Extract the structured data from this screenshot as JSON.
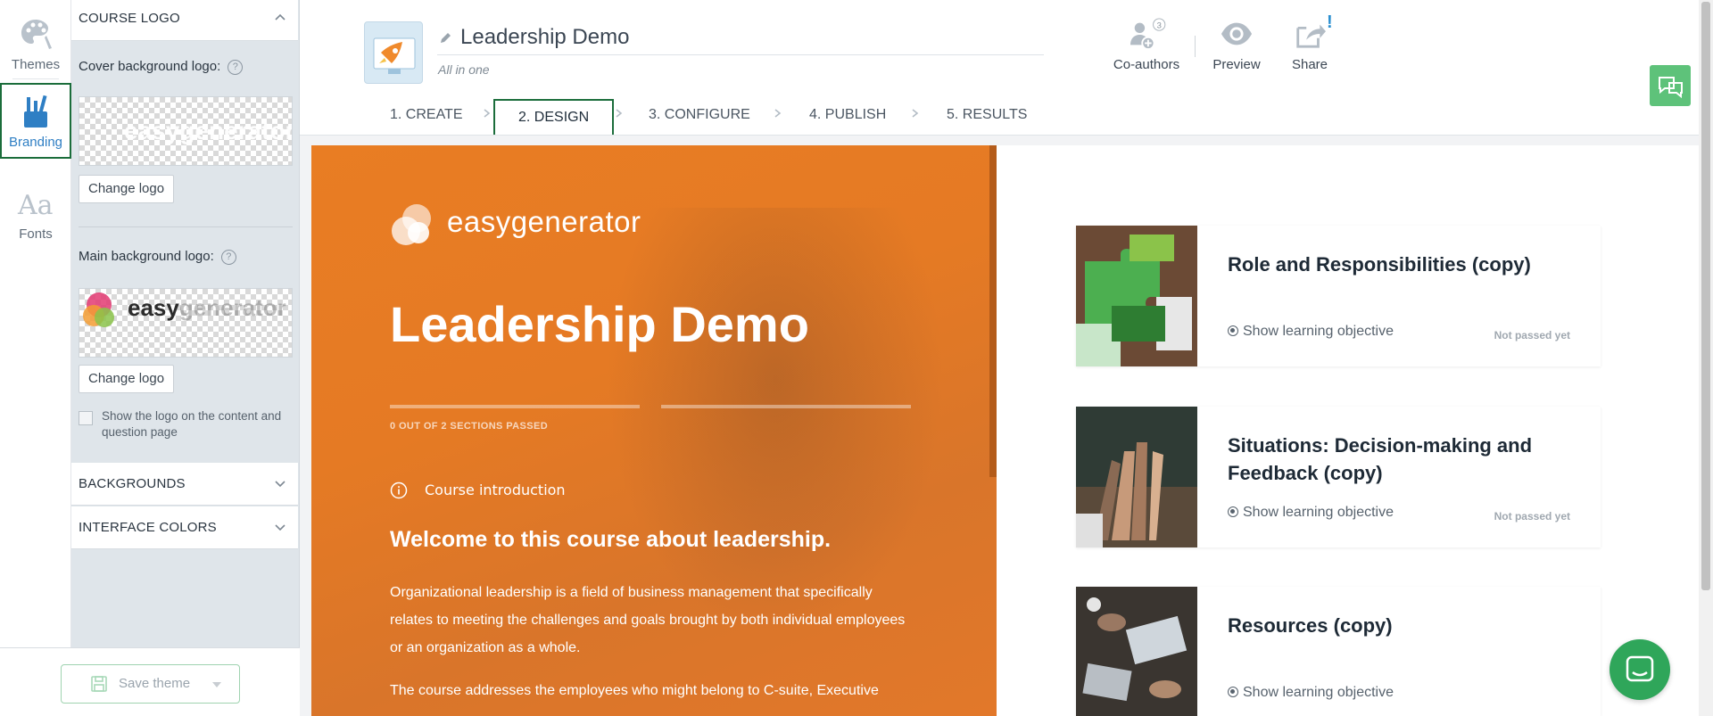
{
  "rail": {
    "items": [
      {
        "label": "Themes",
        "icon": "palette-icon"
      },
      {
        "label": "Branding",
        "icon": "brushes-icon"
      },
      {
        "label": "Fonts",
        "icon": "font-icon"
      }
    ],
    "active": "Branding"
  },
  "panel": {
    "course_logo": "COURSE LOGO",
    "cover_logo_label": "Cover background logo:",
    "main_logo_label": "Main background logo:",
    "change_logo_1": "Change logo",
    "change_logo_2": "Change logo",
    "show_logo_label": "Show the logo on the content and question page",
    "backgrounds": "BACKGROUNDS",
    "interface_colors": "INTERFACE COLORS",
    "save_theme": "Save theme",
    "logo_word_1": "easy",
    "logo_word_2": "generator"
  },
  "header": {
    "title": "Leadership Demo",
    "subtitle": "All in one",
    "coauthors_count": "3",
    "actions": {
      "coauthors": "Co-authors",
      "preview": "Preview",
      "share": "Share",
      "share_badge": "!"
    },
    "steps": [
      "1. CREATE",
      "2. DESIGN",
      "3. CONFIGURE",
      "4. PUBLISH",
      "5. RESULTS"
    ],
    "active_step": "2. DESIGN"
  },
  "preview": {
    "brand": "easygenerator",
    "course_title": "Leadership Demo",
    "progress_text": "0 OUT OF 2 SECTIONS PASSED",
    "intro_label": "Course introduction",
    "welcome": "Welcome to this course about leadership.",
    "para1": "Organizational leadership is a field of business management that specifically relates to meeting the challenges and goals brought by both individual employees or an organization as a whole.",
    "para2": "The course addresses the employees who might belong to C-suite, Executive",
    "accent_color": "#e97d23",
    "sections": [
      {
        "title": "Role and Responsibilities (copy)",
        "objective": "Show learning objective",
        "status": "Not passed yet"
      },
      {
        "title": "Situations: Decision-making and Feedback (copy)",
        "objective": "Show learning objective",
        "status": "Not passed yet"
      },
      {
        "title": "Resources (copy)",
        "objective": "Show learning objective",
        "status": ""
      }
    ]
  }
}
